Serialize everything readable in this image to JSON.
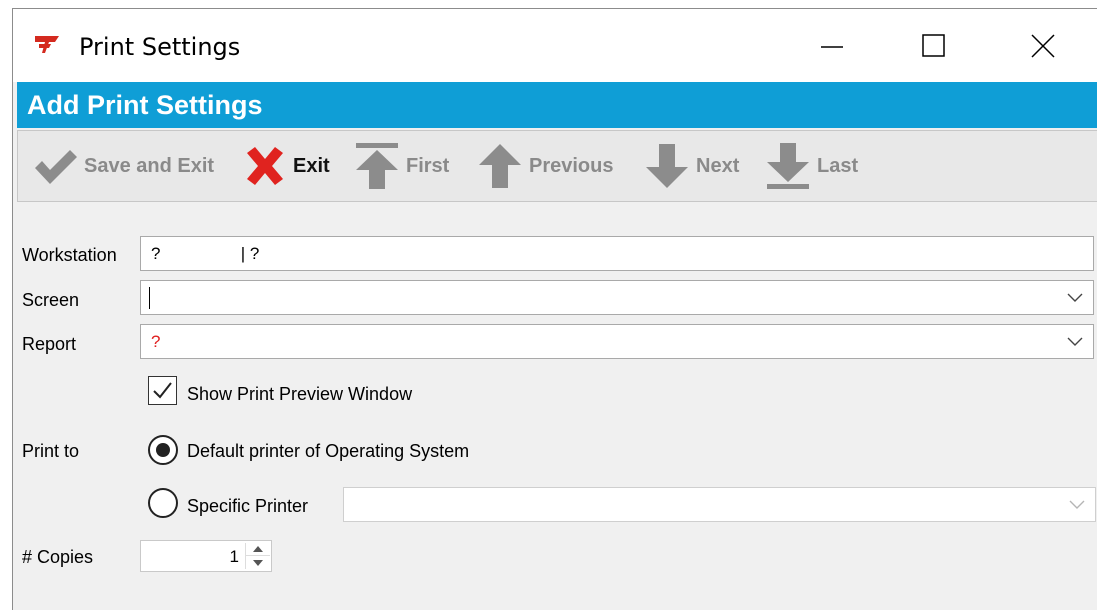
{
  "window": {
    "title": "Print Settings",
    "controls": {
      "minimize": "minimize-icon",
      "maximize": "maximize-icon",
      "close": "close-icon"
    }
  },
  "header": {
    "title": "Add Print Settings",
    "color": "#0f9ed6"
  },
  "toolbar": {
    "save_exit": {
      "label": "Save and Exit",
      "icon": "checkmark-icon",
      "enabled": false
    },
    "exit": {
      "label": "Exit",
      "icon": "red-x-icon",
      "enabled": true
    },
    "first": {
      "label": "First",
      "icon": "arrow-first-icon",
      "enabled": false
    },
    "previous": {
      "label": "Previous",
      "icon": "arrow-up-icon",
      "enabled": false
    },
    "next": {
      "label": "Next",
      "icon": "arrow-down-icon",
      "enabled": false
    },
    "last": {
      "label": "Last",
      "icon": "arrow-last-icon",
      "enabled": false
    }
  },
  "form": {
    "workstation": {
      "label": "Workstation",
      "value": "?                 | ?"
    },
    "screen": {
      "label": "Screen",
      "value": ""
    },
    "report": {
      "label": "Report",
      "value": "?"
    },
    "show_preview": {
      "label": "Show Print Preview Window",
      "checked": true
    },
    "print_to": {
      "label": "Print to",
      "options": [
        {
          "label": "Default printer of Operating System",
          "selected": true
        },
        {
          "label": "Specific Printer",
          "selected": false
        }
      ],
      "specific_printer_value": ""
    },
    "copies": {
      "label": "# Copies",
      "value": "1"
    }
  },
  "colors": {
    "accent": "#0f9ed6",
    "exit_red": "#e0231f",
    "disabled_gray": "#8a8a8a",
    "report_error": "#e02020"
  }
}
